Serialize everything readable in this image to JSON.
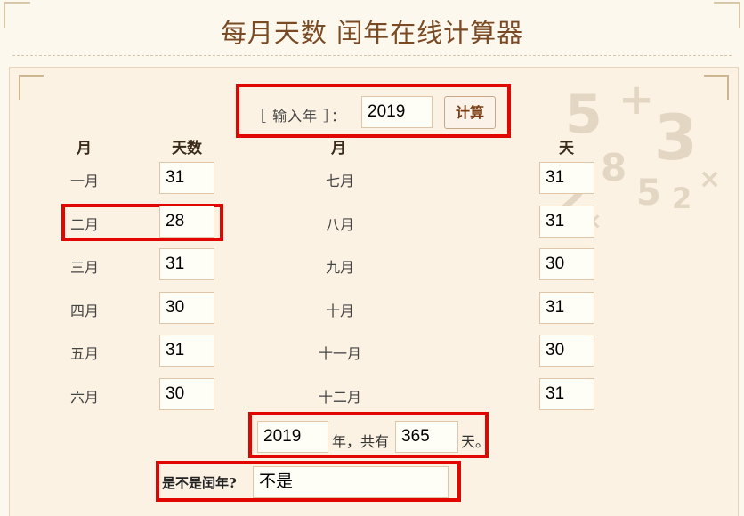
{
  "header": {
    "title": "每月天数 闰年在线计算器"
  },
  "year_input": {
    "label": "［ 输入年 ］：",
    "value": "2019",
    "button_label": "计算"
  },
  "columns": {
    "left_month": "月",
    "left_days": "天数",
    "right_month": "月",
    "right_days": "天"
  },
  "months": [
    {
      "name": "一月",
      "days": "31"
    },
    {
      "name": "二月",
      "days": "28"
    },
    {
      "name": "三月",
      "days": "31"
    },
    {
      "name": "四月",
      "days": "30"
    },
    {
      "name": "五月",
      "days": "31"
    },
    {
      "name": "六月",
      "days": "30"
    },
    {
      "name": "七月",
      "days": "31"
    },
    {
      "name": "八月",
      "days": "31"
    },
    {
      "name": "九月",
      "days": "30"
    },
    {
      "name": "十月",
      "days": "31"
    },
    {
      "name": "十一月",
      "days": "30"
    },
    {
      "name": "十二月",
      "days": "31"
    }
  ],
  "summary": {
    "year": "2019",
    "text_mid": "年，共有",
    "total_days": "365",
    "text_end": "天。"
  },
  "leap": {
    "label": "是不是闰年?",
    "value": "不是"
  },
  "highlight_color": "#e10600"
}
